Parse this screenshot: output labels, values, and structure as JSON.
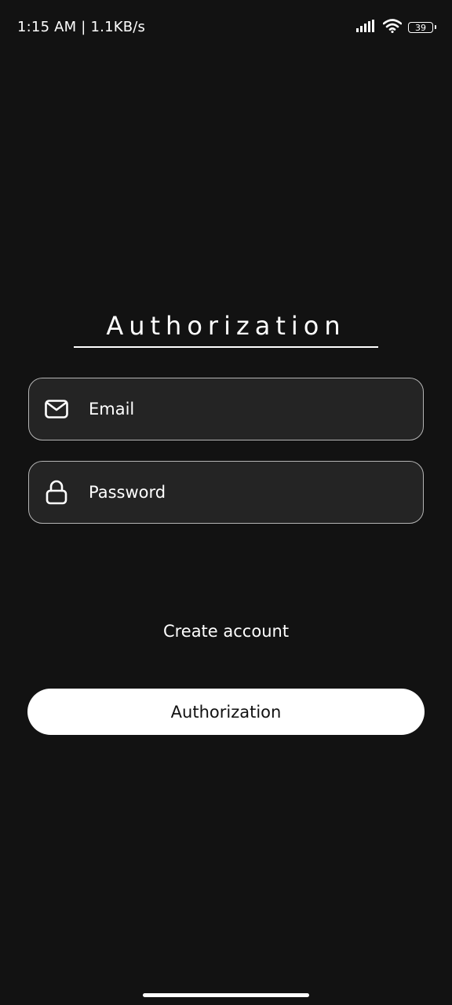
{
  "status_bar": {
    "time": "1:15 AM | 1.1KB/s",
    "battery_level": "39",
    "icons": [
      "signal-icon",
      "wifi-icon",
      "battery-icon"
    ]
  },
  "auth": {
    "title": "Authorization",
    "email": {
      "placeholder": "Email",
      "value": "",
      "icon": "mail-icon"
    },
    "password": {
      "placeholder": "Password",
      "value": "",
      "icon": "lock-icon"
    },
    "create_account_label": "Create account",
    "submit_label": "Authorization"
  },
  "colors": {
    "background": "#121212",
    "field_background": "#242424",
    "field_border": "#b5b5b5",
    "text": "#ffffff",
    "button_background": "#ffffff",
    "button_text": "#111111"
  }
}
